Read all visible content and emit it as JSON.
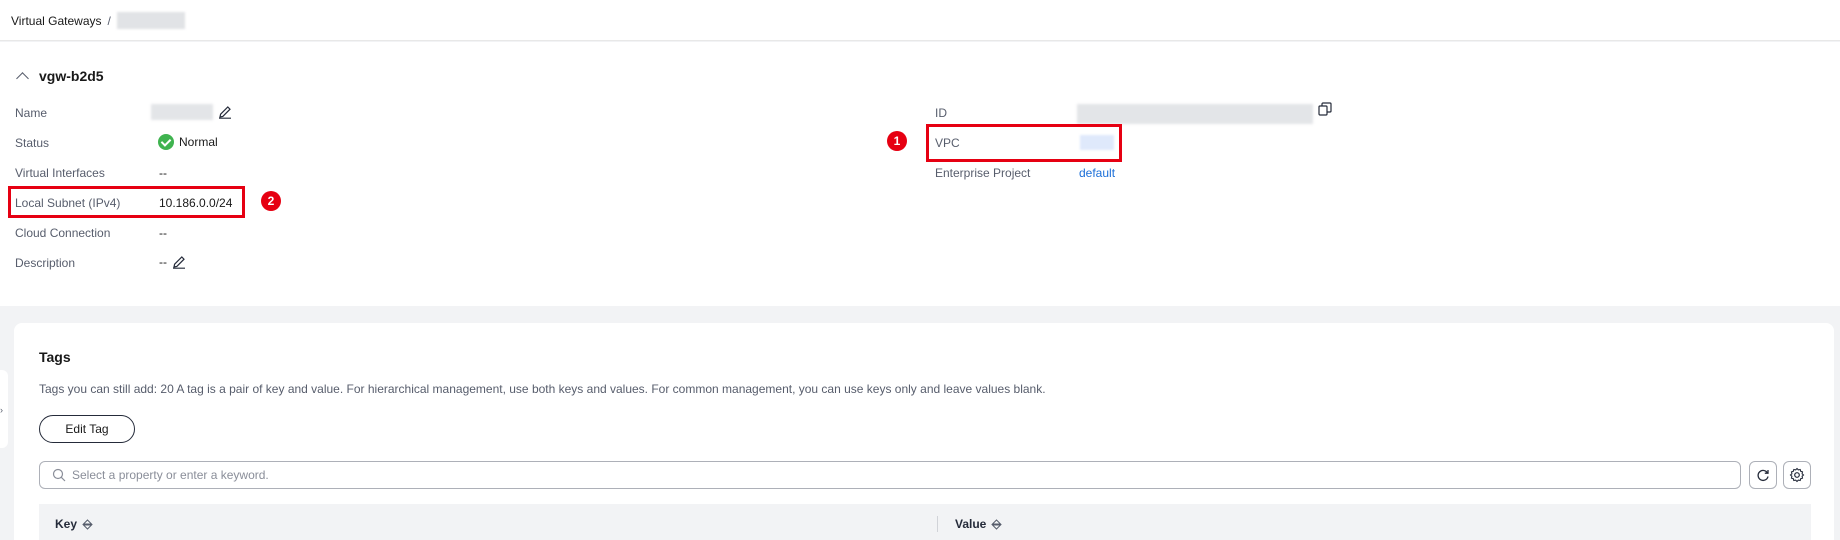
{
  "breadcrumb": {
    "root": "Virtual Gateways",
    "separator": "/"
  },
  "gateway": {
    "title": "vgw-b2d5",
    "fields": {
      "name_label": "Name",
      "status_label": "Status",
      "status_value": "Normal",
      "virtual_interfaces_label": "Virtual Interfaces",
      "virtual_interfaces_value": "--",
      "local_subnet_label": "Local Subnet (IPv4)",
      "local_subnet_value": "10.186.0.0/24",
      "cloud_connection_label": "Cloud Connection",
      "cloud_connection_value": "--",
      "description_label": "Description",
      "description_value": "--",
      "id_label": "ID",
      "vpc_label": "VPC",
      "enterprise_project_label": "Enterprise Project",
      "enterprise_project_value": "default"
    }
  },
  "annotations": {
    "badge_1": "1",
    "badge_2": "2",
    "color": "#e60012"
  },
  "tags": {
    "title": "Tags",
    "description": "Tags you can still add: 20 A tag is a pair of key and value. For hierarchical management, use both keys and values. For common management, you can use keys only and leave values blank.",
    "edit_button": "Edit Tag",
    "search_placeholder": "Select a property or enter a keyword.",
    "columns": [
      "Key",
      "Value"
    ]
  },
  "colors": {
    "status_ok": "#3fb34f",
    "link": "#1a6ed8"
  }
}
